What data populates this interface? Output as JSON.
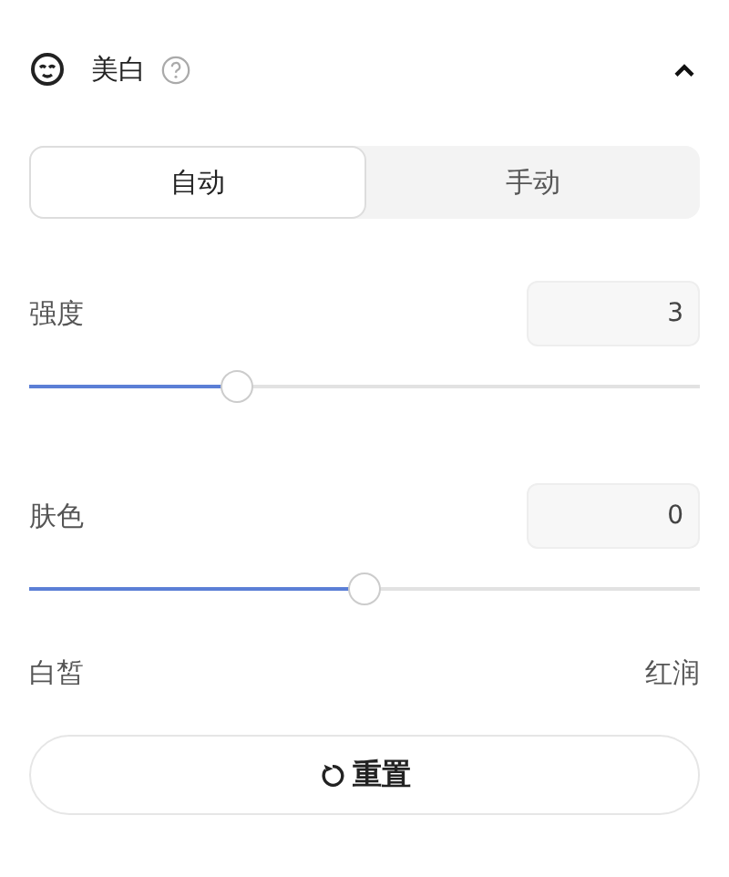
{
  "section": {
    "title": "美白",
    "expanded": true
  },
  "tabs": [
    {
      "label": "自动",
      "selected": true
    },
    {
      "label": "手动",
      "selected": false
    }
  ],
  "sliders": [
    {
      "label": "强度",
      "value": "3",
      "level": 0.31
    },
    {
      "label": "肤色",
      "value": "0",
      "level": 0.5
    }
  ],
  "scale": {
    "left": "白皙",
    "right": "红润"
  },
  "reset_button": "重置"
}
